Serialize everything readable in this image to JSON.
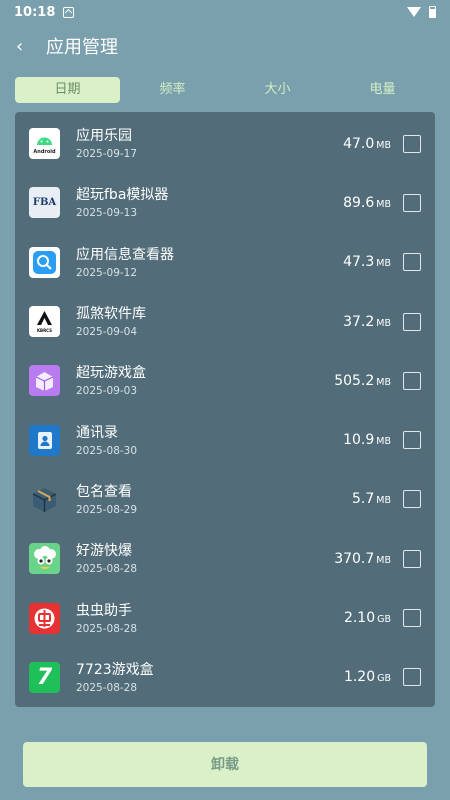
{
  "status_bar": {
    "time": "10:18"
  },
  "header": {
    "back": "‹",
    "title": "应用管理"
  },
  "tabs": [
    {
      "label": "日期",
      "active": true
    },
    {
      "label": "频率",
      "active": false
    },
    {
      "label": "大小",
      "active": false
    },
    {
      "label": "电量",
      "active": false
    }
  ],
  "apps": [
    {
      "name": "应用乐园",
      "date": "2025-09-17",
      "size": "47.0",
      "unit": "MB",
      "icon": "android-icon"
    },
    {
      "name": "超玩fba模拟器",
      "date": "2025-09-13",
      "size": "89.6",
      "unit": "MB",
      "icon": "fba-icon"
    },
    {
      "name": "应用信息查看器",
      "date": "2025-09-12",
      "size": "47.3",
      "unit": "MB",
      "icon": "app-info-search-icon"
    },
    {
      "name": "孤煞软件库",
      "date": "2025-09-04",
      "size": "37.2",
      "unit": "MB",
      "icon": "gusha-logo-icon"
    },
    {
      "name": "超玩游戏盒",
      "date": "2025-09-03",
      "size": "505.2",
      "unit": "MB",
      "icon": "game-box-icon"
    },
    {
      "name": "通讯录",
      "date": "2025-08-30",
      "size": "10.9",
      "unit": "MB",
      "icon": "contacts-icon"
    },
    {
      "name": "包名查看",
      "date": "2025-08-29",
      "size": "5.7",
      "unit": "MB",
      "icon": "package-box-icon"
    },
    {
      "name": "好游快爆",
      "date": "2025-08-28",
      "size": "370.7",
      "unit": "MB",
      "icon": "haoyou-popcorn-icon"
    },
    {
      "name": "虫虫助手",
      "date": "2025-08-28",
      "size": "2.10",
      "unit": "GB",
      "icon": "chongchong-icon"
    },
    {
      "name": "7723游戏盒",
      "date": "2025-08-28",
      "size": "1.20",
      "unit": "GB",
      "icon": "7723-icon"
    }
  ],
  "icon_labels": {
    "android": "Android",
    "fba": "FBA",
    "gusha": "KBRCS",
    "qqq": "7"
  },
  "footer": {
    "uninstall_label": "卸载"
  }
}
